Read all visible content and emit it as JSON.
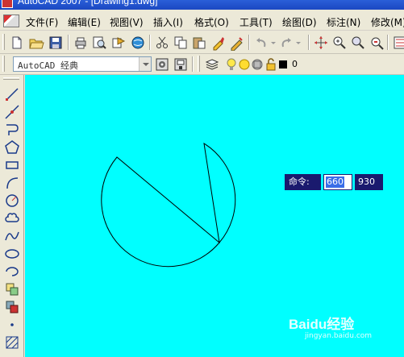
{
  "window": {
    "title": "AutoCAD 2007 - [Drawing1.dwg]"
  },
  "menu": [
    {
      "label": "文件(F)"
    },
    {
      "label": "编辑(E)"
    },
    {
      "label": "视图(V)"
    },
    {
      "label": "插入(I)"
    },
    {
      "label": "格式(O)"
    },
    {
      "label": "工具(T)"
    },
    {
      "label": "绘图(D)"
    },
    {
      "label": "标注(N)"
    },
    {
      "label": "修改(M)"
    }
  ],
  "workspace": {
    "value": "AutoCAD 经典"
  },
  "layer": {
    "name": "0"
  },
  "dynamic_input": {
    "prompt": "命令:",
    "x_value": "660",
    "y_value": "930"
  },
  "watermark": {
    "brand": "Baidu经验",
    "url": "jingyan.baidu.com"
  },
  "colors": {
    "canvas_background": "#00ffff",
    "tooltip_background": "#1a1a6e",
    "input_highlight": "#3a6ee8"
  }
}
